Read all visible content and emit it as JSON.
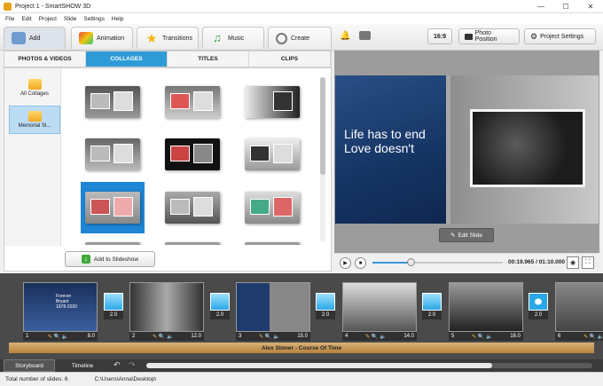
{
  "window": {
    "title": "Project 1 - SmartSHOW 3D",
    "controls": [
      "—",
      "☐",
      "✕"
    ]
  },
  "menu": [
    "File",
    "Edit",
    "Project",
    "Slide",
    "Settings",
    "Help"
  ],
  "main_tabs": [
    {
      "label": "Add",
      "icon": "add-photo-icon"
    },
    {
      "label": "Animation",
      "icon": "palette-icon"
    },
    {
      "label": "Transitions",
      "icon": "star-icon"
    },
    {
      "label": "Music",
      "icon": "music-note-icon"
    },
    {
      "label": "Create",
      "icon": "film-reel-icon"
    }
  ],
  "toolbar": {
    "aspect": "16:9",
    "photo_position": "Photo Position",
    "project_settings": "Project Settings"
  },
  "sub_tabs": [
    "PHOTOS & VIDEOS",
    "COLLAGES",
    "TITLES",
    "CLIPS"
  ],
  "categories": [
    "All Collages",
    "Memorial Sl..."
  ],
  "add_button": "Add to Slideshow",
  "preview": {
    "slide_text": "Life has to end\nLove doesn't",
    "edit_slide": "Edit Slide",
    "time": "00:19.965 / 01:10.000"
  },
  "slides": [
    {
      "num": "1",
      "duration": "8.0",
      "caption": "Forever\nBryant\n1978-2020"
    },
    {
      "num": "2",
      "duration": "12.0"
    },
    {
      "num": "3",
      "duration": "15.0"
    },
    {
      "num": "4",
      "duration": "14.0"
    },
    {
      "num": "5",
      "duration": "16.0"
    },
    {
      "num": "6",
      "duration": ""
    }
  ],
  "transitions": [
    "2.0",
    "2.0",
    "2.0",
    "2.0",
    "2.0",
    "2.0"
  ],
  "audio_track": "Alex Stoner - Course Of Time",
  "bottom_tabs": [
    "Storyboard",
    "Timeline"
  ],
  "status": {
    "total": "Total number of slides: 6",
    "path": "C:\\Users\\Anna\\Desktop\\"
  },
  "colors": {
    "accent": "#2e9bd6",
    "selected": "#1f86d6",
    "audio": "#c9965a"
  }
}
